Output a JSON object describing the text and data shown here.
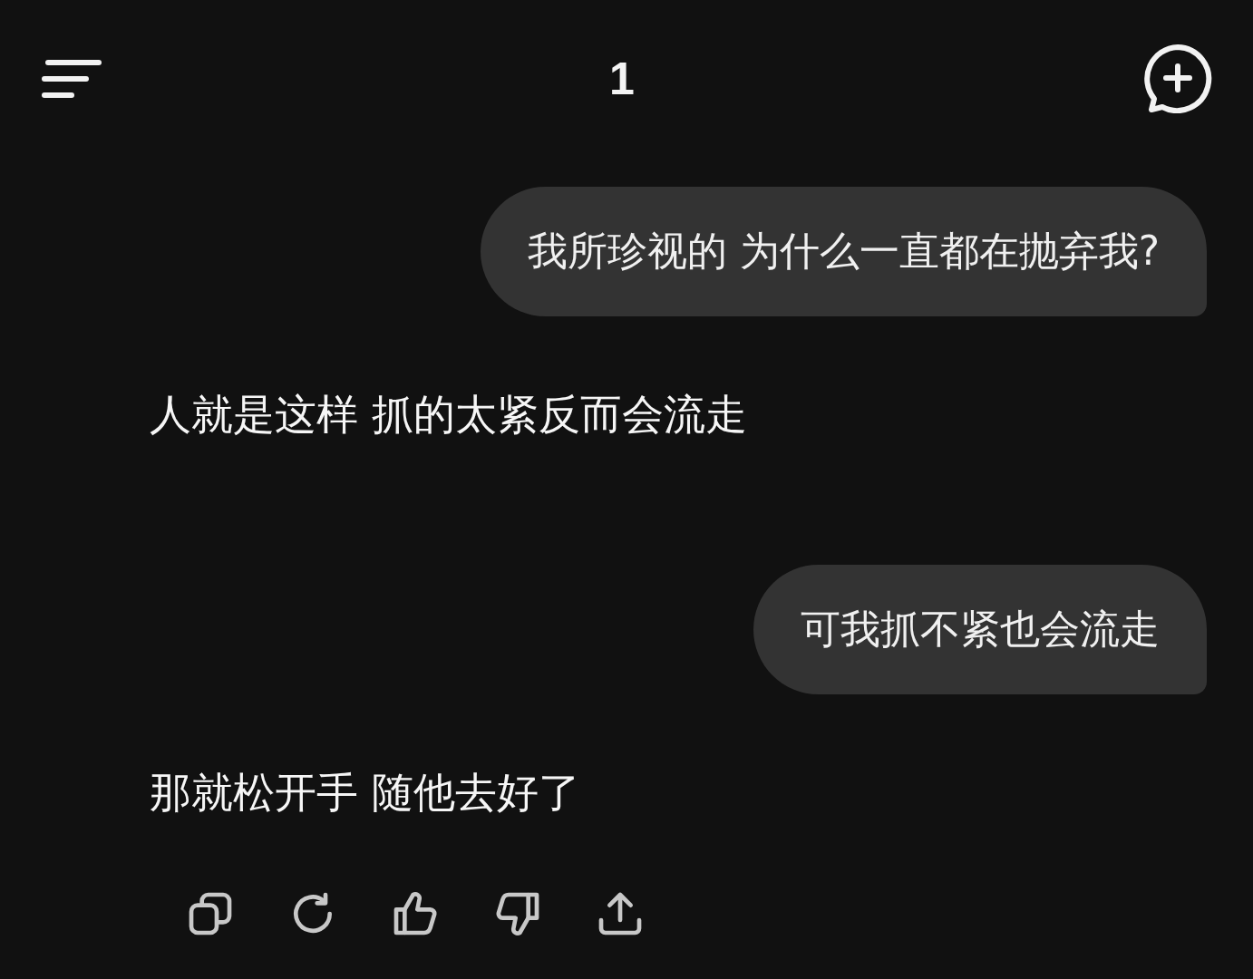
{
  "header": {
    "title": "1"
  },
  "messages": [
    {
      "kind": "user",
      "text": "我所珍视的 为什么一直都在抛弃我?"
    },
    {
      "kind": "assistant",
      "text": "人就是这样 抓的太紧反而会流走"
    },
    {
      "kind": "user",
      "text": "可我抓不紧也会流走"
    },
    {
      "kind": "assistant",
      "text": "那就松开手 随他去好了"
    }
  ]
}
